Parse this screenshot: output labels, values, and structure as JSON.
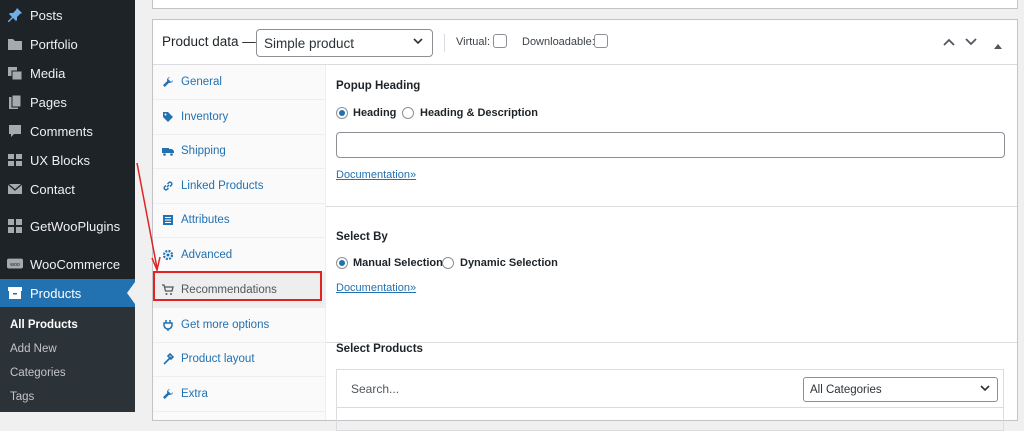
{
  "sidebar": {
    "items": [
      {
        "label": "Posts",
        "icon": "pin-icon"
      },
      {
        "label": "Portfolio",
        "icon": "folder-icon"
      },
      {
        "label": "Media",
        "icon": "media-icon"
      },
      {
        "label": "Pages",
        "icon": "pages-icon"
      },
      {
        "label": "Comments",
        "icon": "comments-icon"
      },
      {
        "label": "UX Blocks",
        "icon": "blocks-icon"
      },
      {
        "label": "Contact",
        "icon": "mail-icon"
      },
      {
        "label": "GetWooPlugins",
        "icon": "grid-icon"
      },
      {
        "label": "WooCommerce",
        "icon": "woo-icon"
      },
      {
        "label": "Products",
        "icon": "archive-icon"
      }
    ],
    "submenu": [
      "All Products",
      "Add New",
      "Categories",
      "Tags"
    ]
  },
  "product_data": {
    "title": "Product data —",
    "type_select": "Simple product",
    "virtual_label": "Virtual:",
    "downloadable_label": "Downloadable:",
    "virtual_checked": false,
    "downloadable_checked": false
  },
  "tabs": [
    {
      "label": "General",
      "icon": "wrench-icon"
    },
    {
      "label": "Inventory",
      "icon": "tag-icon"
    },
    {
      "label": "Shipping",
      "icon": "truck-icon"
    },
    {
      "label": "Linked Products",
      "icon": "link-icon"
    },
    {
      "label": "Attributes",
      "icon": "list-icon"
    },
    {
      "label": "Advanced",
      "icon": "gear-icon"
    },
    {
      "label": "Recommendations",
      "icon": "cart-icon"
    },
    {
      "label": "Get more options",
      "icon": "plug-icon"
    },
    {
      "label": "Product layout",
      "icon": "layout-icon"
    },
    {
      "label": "Extra",
      "icon": "wrench-icon"
    }
  ],
  "active_tab": "Recommendations",
  "popup_heading": {
    "title": "Popup Heading",
    "option_1": "Heading",
    "option_2": "Heading & Description",
    "selected": "Heading",
    "input_value": "",
    "doc_link": "Documentation»"
  },
  "select_by": {
    "title": "Select By",
    "option_1": "Manual Selection",
    "option_2": "Dynamic Selection",
    "selected": "Manual Selection",
    "doc_link": "Documentation»"
  },
  "select_products": {
    "title": "Select Products",
    "search_placeholder": "Search...",
    "category_select": "All Categories"
  },
  "colors": {
    "admin_bar": "#1d2327",
    "accent": "#2271b1",
    "highlight": "#e02424"
  }
}
